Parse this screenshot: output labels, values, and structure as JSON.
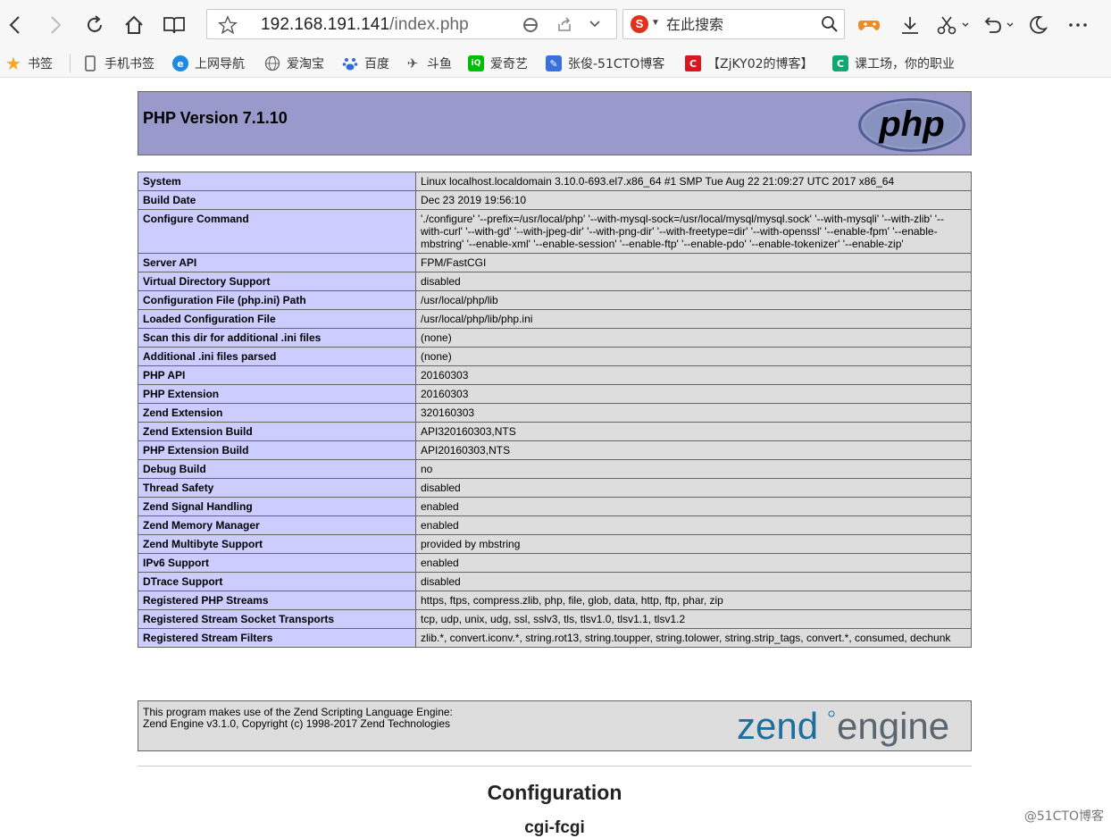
{
  "browser": {
    "url_host": "192.168.191.141",
    "url_path": "/index.php",
    "search_placeholder": "在此搜索",
    "bookmarks": [
      {
        "label": "书签",
        "icon": "star-icon"
      },
      {
        "label": "手机书签",
        "icon": "phone-icon"
      },
      {
        "label": "上网导航",
        "icon": "navigation-icon"
      },
      {
        "label": "爱淘宝",
        "icon": "globe-icon"
      },
      {
        "label": "百度",
        "icon": "baidu-paw-icon"
      },
      {
        "label": "斗鱼",
        "icon": "douyu-icon"
      },
      {
        "label": "爱奇艺",
        "icon": "iqiyi-icon"
      },
      {
        "label": "张俊-51CTO博客",
        "icon": "feather-icon"
      },
      {
        "label": "【ZjKY02的博客】",
        "icon": "csdn-icon"
      },
      {
        "label": "课工场，你的职业",
        "icon": "kgc-icon"
      }
    ]
  },
  "php": {
    "header_title": "PHP Version 7.1.10",
    "logo_text": "php",
    "rows": [
      {
        "key": "System",
        "value": "Linux localhost.localdomain 3.10.0-693.el7.x86_64 #1 SMP Tue Aug 22 21:09:27 UTC 2017 x86_64"
      },
      {
        "key": "Build Date",
        "value": "Dec 23 2019 19:56:10"
      },
      {
        "key": "Configure Command",
        "value": "'./configure' '--prefix=/usr/local/php' '--with-mysql-sock=/usr/local/mysql/mysql.sock' '--with-mysqli' '--with-zlib' '--with-curl' '--with-gd' '--with-jpeg-dir' '--with-png-dir' '--with-freetype=dir' '--with-openssl' '--enable-fpm' '--enable-mbstring' '--enable-xml' '--enable-session' '--enable-ftp' '--enable-pdo' '--enable-tokenizer' '--enable-zip'"
      },
      {
        "key": "Server API",
        "value": "FPM/FastCGI"
      },
      {
        "key": "Virtual Directory Support",
        "value": "disabled"
      },
      {
        "key": "Configuration File (php.ini) Path",
        "value": "/usr/local/php/lib"
      },
      {
        "key": "Loaded Configuration File",
        "value": "/usr/local/php/lib/php.ini"
      },
      {
        "key": "Scan this dir for additional .ini files",
        "value": "(none)"
      },
      {
        "key": "Additional .ini files parsed",
        "value": "(none)"
      },
      {
        "key": "PHP API",
        "value": "20160303"
      },
      {
        "key": "PHP Extension",
        "value": "20160303"
      },
      {
        "key": "Zend Extension",
        "value": "320160303"
      },
      {
        "key": "Zend Extension Build",
        "value": "API320160303,NTS"
      },
      {
        "key": "PHP Extension Build",
        "value": "API20160303,NTS"
      },
      {
        "key": "Debug Build",
        "value": "no"
      },
      {
        "key": "Thread Safety",
        "value": "disabled"
      },
      {
        "key": "Zend Signal Handling",
        "value": "enabled"
      },
      {
        "key": "Zend Memory Manager",
        "value": "enabled"
      },
      {
        "key": "Zend Multibyte Support",
        "value": "provided by mbstring"
      },
      {
        "key": "IPv6 Support",
        "value": "enabled"
      },
      {
        "key": "DTrace Support",
        "value": "disabled"
      },
      {
        "key": "Registered PHP Streams",
        "value": "https, ftps, compress.zlib, php, file, glob, data, http, ftp, phar, zip"
      },
      {
        "key": "Registered Stream Socket Transports",
        "value": "tcp, udp, unix, udg, ssl, sslv3, tls, tlsv1.0, tlsv1.1, tlsv1.2"
      },
      {
        "key": "Registered Stream Filters",
        "value": "zlib.*, convert.iconv.*, string.rot13, string.toupper, string.tolower, string.strip_tags, convert.*, consumed, dechunk"
      }
    ],
    "zend_line1": "This program makes use of the Zend Scripting Language Engine:",
    "zend_line2": "Zend Engine v3.1.0, Copyright (c) 1998-2017 Zend Technologies",
    "zend_logo_left": "zend",
    "zend_logo_right": "engine",
    "section_title": "Configuration",
    "subsection_title": "cgi-fcgi"
  },
  "watermark": "@51CTO博客",
  "colors": {
    "php_header": "#9999cc",
    "key_cell": "#ccccff",
    "value_cell": "#dddddd",
    "zend_blue": "#1f6f9e",
    "zend_grey": "#5a6670"
  }
}
